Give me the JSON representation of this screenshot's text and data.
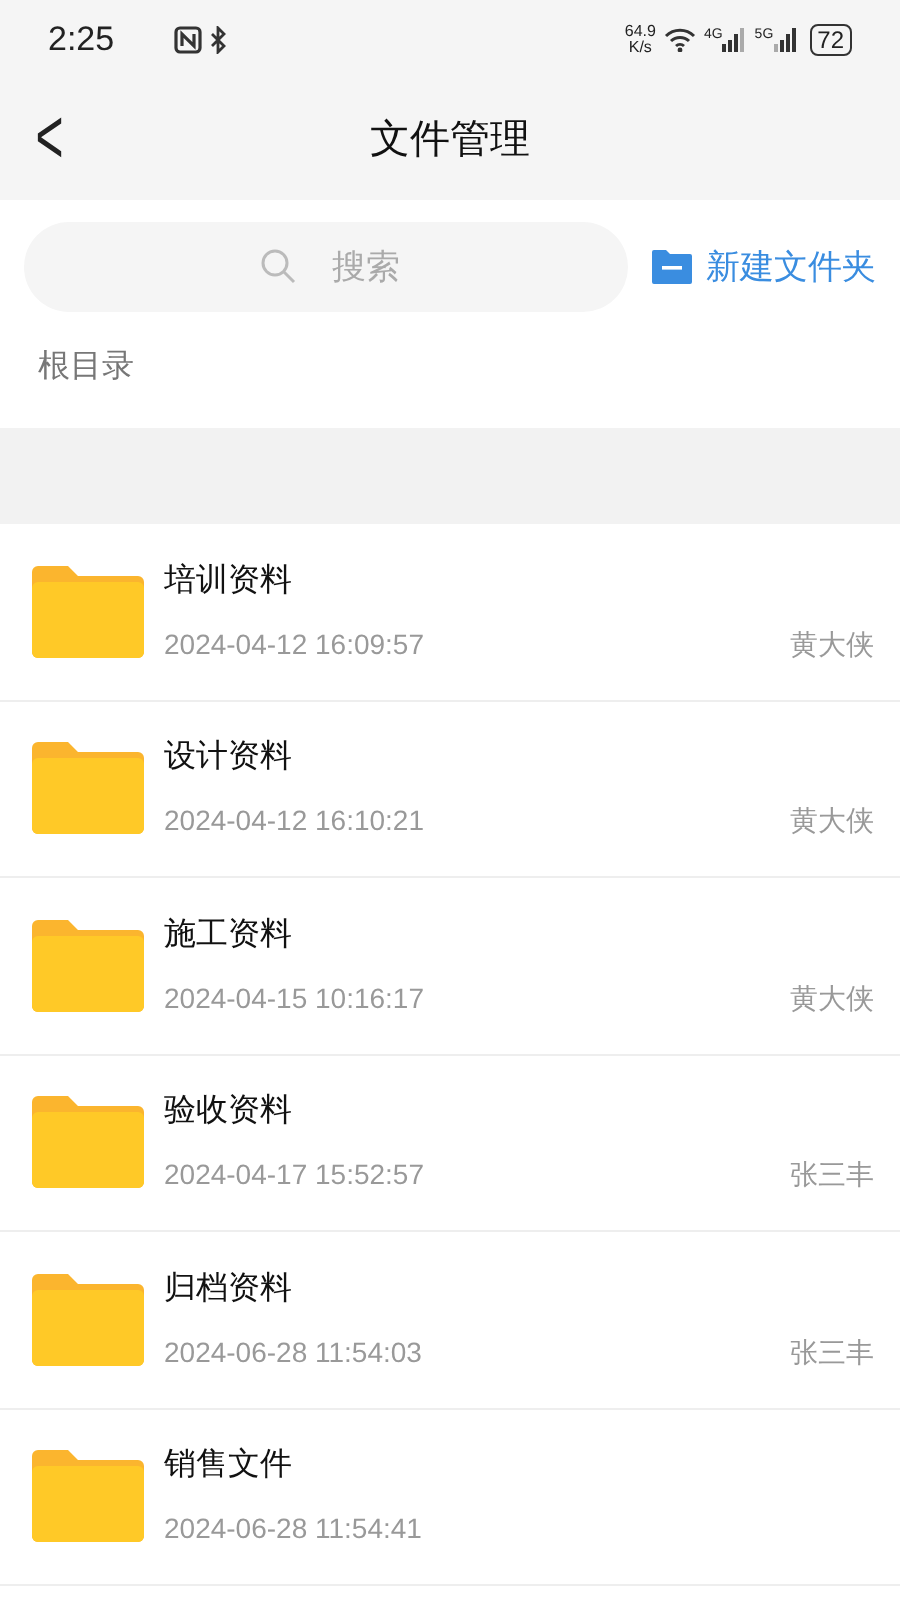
{
  "status_bar": {
    "time": "2:25",
    "speed_value": "64.9",
    "speed_unit": "K/s",
    "network_1": "4G",
    "network_2": "5G",
    "battery": "72"
  },
  "header": {
    "back": "<",
    "title": "文件管理"
  },
  "search": {
    "placeholder": "搜索"
  },
  "new_folder_button": "新建文件夹",
  "breadcrumb": "根目录",
  "files": [
    {
      "name": "培训资料",
      "date": "2024-04-12 16:09:57",
      "author": "黄大侠"
    },
    {
      "name": "设计资料",
      "date": "2024-04-12 16:10:21",
      "author": "黄大侠"
    },
    {
      "name": "施工资料",
      "date": "2024-04-15 10:16:17",
      "author": "黄大侠"
    },
    {
      "name": "验收资料",
      "date": "2024-04-17 15:52:57",
      "author": "张三丰"
    },
    {
      "name": "归档资料",
      "date": "2024-06-28 11:54:03",
      "author": "张三丰"
    },
    {
      "name": "销售文件",
      "date": "2024-06-28 11:54:41"
    }
  ]
}
